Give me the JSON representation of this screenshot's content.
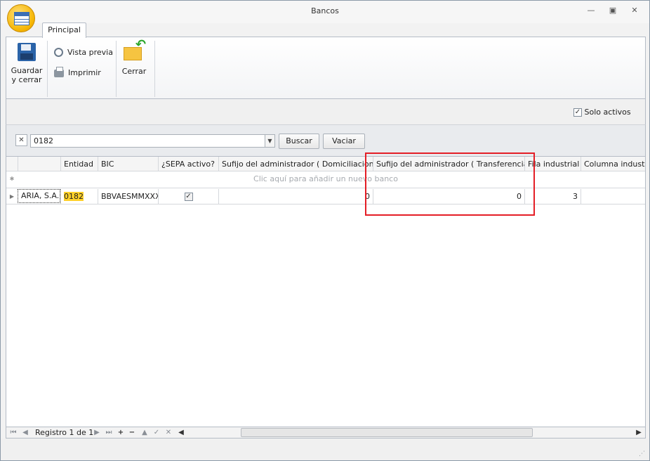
{
  "window": {
    "title": "Bancos"
  },
  "ribbon": {
    "tab_label": "Principal",
    "save_label_line1": "Guardar",
    "save_label_line2": "y cerrar",
    "preview_label": "Vista previa",
    "print_label": "Imprimir",
    "close_label": "Cerrar"
  },
  "options": {
    "solo_activos_label": "Solo activos",
    "solo_activos_checked": true
  },
  "search": {
    "value": "0182",
    "search_button": "Buscar",
    "clear_button": "Vaciar"
  },
  "grid": {
    "columns": [
      "",
      "Entidad",
      "BIC",
      "¿SEPA activo?",
      "Sufijo del administrador ( Domiciliaciones ...",
      "Sufijo del administrador ( Transferencias ...",
      "Fila industrial",
      "Columna industrial"
    ],
    "new_row_text": "Clic aquí para añadir un nuevo banco",
    "rows": [
      {
        "name": "ARIA, S.A.",
        "entidad": "0182",
        "bic": "BBVAESMMXXX",
        "sepa": true,
        "sufijo_dom": "0",
        "sufijo_trans": "0",
        "fila": "3",
        "columna": ""
      }
    ]
  },
  "navigator": {
    "record_text": "Registro 1 de 1"
  },
  "colors": {
    "highlight": "#ffd12a",
    "annotation_box": "#e41e26"
  },
  "icons": [
    "app-logo-icon",
    "save-icon",
    "preview-icon",
    "print-icon",
    "close-folder-icon",
    "clear-filter-icon",
    "dropdown-arrow-icon"
  ]
}
